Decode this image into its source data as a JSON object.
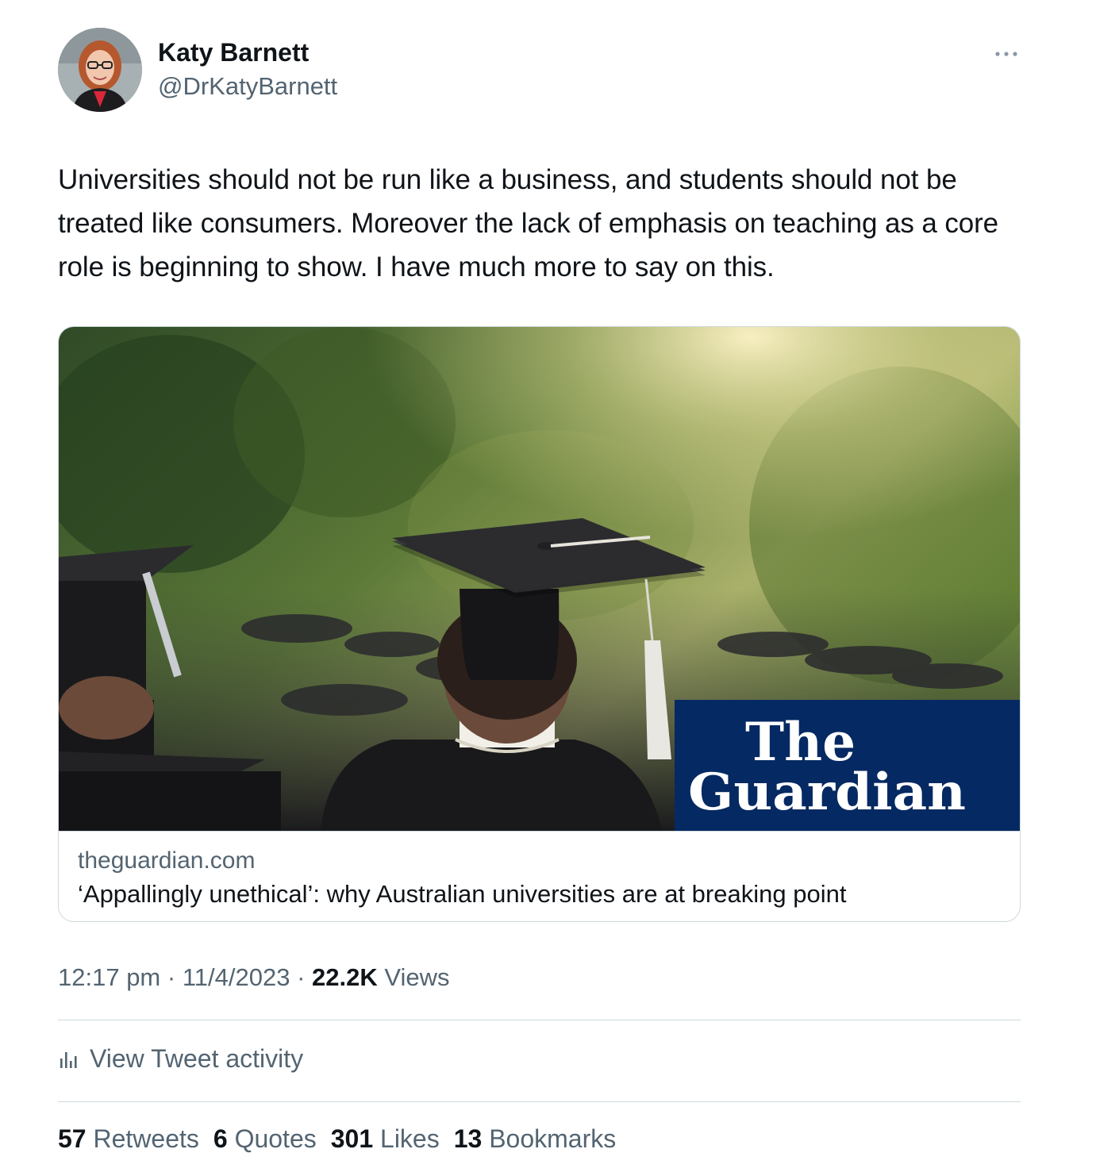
{
  "author": {
    "name": "Katy Barnett",
    "handle": "@DrKatyBarnett"
  },
  "icons": {
    "more": "more-options-icon",
    "analytics": "bar-chart-icon"
  },
  "tweet": {
    "text": "Universities should not be run like a business, and students should not be treated like consumers. Moreover the lack of emphasis on teaching as a core role is beginning to show. I have much more to say on this."
  },
  "card": {
    "domain": "theguardian.com",
    "title": "‘Appallingly unethical’: why Australian universities are at breaking point",
    "logo_line1": "The",
    "logo_line2": "Guardian"
  },
  "meta": {
    "time": "12:17 pm",
    "sep1": " · ",
    "date": "11/4/2023",
    "sep2": " · ",
    "views_count": "22.2K",
    "views_label": " Views"
  },
  "activity": {
    "label": "View Tweet activity"
  },
  "stats": {
    "retweets_count": "57",
    "retweets_label": " Retweets",
    "quotes_count": "6",
    "quotes_label": " Quotes",
    "likes_count": "301",
    "likes_label": " Likes",
    "bookmarks_count": "13",
    "bookmarks_label": " Bookmarks"
  },
  "colors": {
    "text_primary": "#0f1419",
    "text_secondary": "#536471",
    "border": "#cfd9de",
    "guardian_blue": "#052962"
  }
}
